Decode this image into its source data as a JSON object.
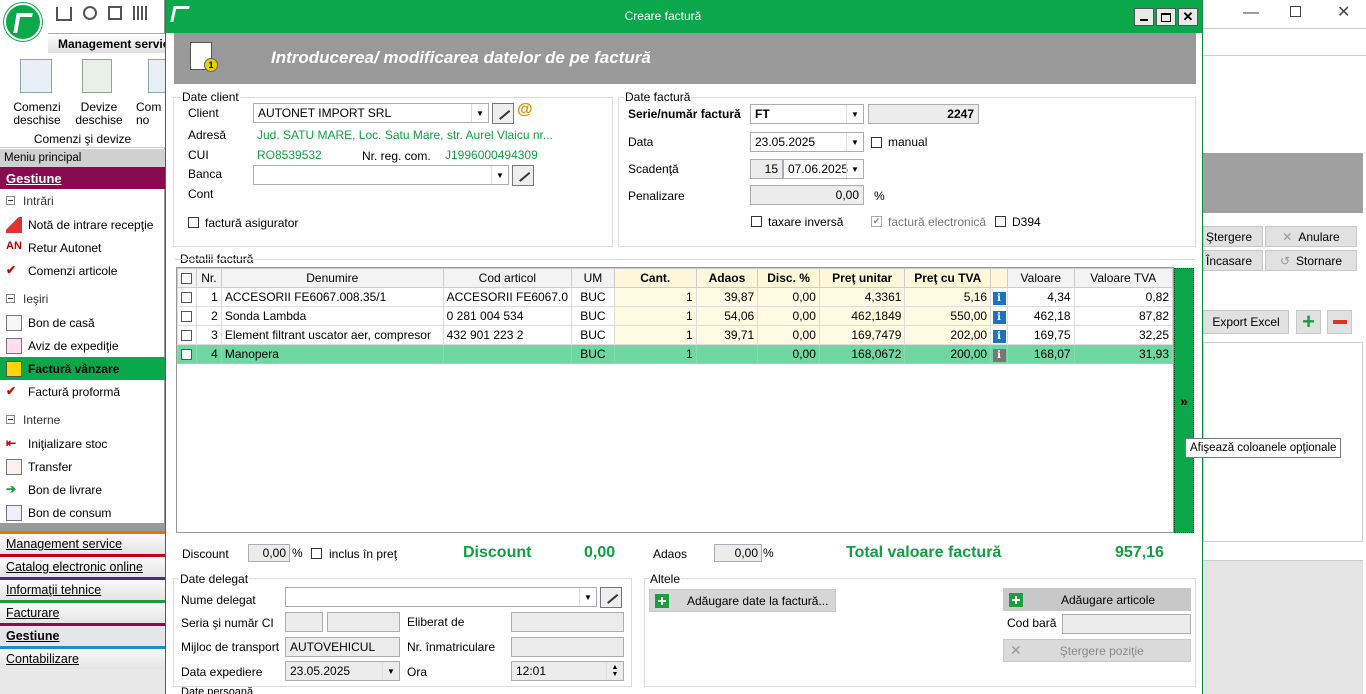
{
  "left_app": {
    "toolbar_title": "Management service",
    "ribbon_items": [
      {
        "label": "Comenzi\ndeschise"
      },
      {
        "label": "Devize\ndeschise"
      },
      {
        "label": "Com\nno"
      }
    ],
    "ribbon_group": "Comenzi şi devize",
    "menu_header": "Meniu principal",
    "section_title": "Gestiune",
    "groups": [
      {
        "label": "Intrări",
        "items": [
          "Notă de intrare recepţie",
          "Retur Autonet",
          "Comenzi articole"
        ]
      },
      {
        "label": "Ieşiri",
        "items": [
          "Bon de casă",
          "Aviz de expediţie",
          "Factură vânzare",
          "Factură proformă"
        ]
      },
      {
        "label": "Interne",
        "items": [
          "Iniţializare stoc",
          "Transfer",
          "Bon de livrare",
          "Bon de consum"
        ]
      }
    ],
    "active_item": "Factură vânzare",
    "modules": [
      "Management service",
      "Catalog electronic online",
      "Informaţii tehnice",
      "Facturare",
      "Gestiune",
      "Contabilizare"
    ],
    "module_colors": [
      "#e07b00",
      "#c00018",
      "#4b2b8a",
      "#1f9a40",
      "#8a0a50",
      "#1a8fc8"
    ]
  },
  "right_app": {
    "buttons": {
      "stergere": "Ştergere",
      "anulare": "Anulare",
      "incasare": "Încasare",
      "stornare": "Stornare",
      "export": "Export Excel"
    },
    "tooltip": "Afişează coloanele opţionale"
  },
  "dialog": {
    "title": "Creare factură",
    "banner": "Introducerea/ modificarea datelor de pe factură",
    "client_section": {
      "legend": "Date client",
      "client_label": "Client",
      "client_value": "AUTONET IMPORT SRL",
      "adresa_label": "Adresă",
      "adresa_value": "Jud. SATU MARE, Loc. Satu Mare, str. Aurel Vlaicu nr...",
      "cui_label": "CUI",
      "cui_value": "RO8539532",
      "nrreg_label": "Nr. reg. com.",
      "nrreg_value": "J1996000494309",
      "banca_label": "Banca",
      "cont_label": "Cont",
      "asigurator_label": "factură asigurator"
    },
    "invoice_section": {
      "legend": "Date factură",
      "serie_label": "Serie/număr factură",
      "serie_value": "FT",
      "numar_value": "2247",
      "data_label": "Data",
      "data_value": "23.05.2025",
      "manual_label": "manual",
      "scadenta_label": "Scadenţă",
      "scadenta_days": "15",
      "scadenta_date": "07.06.2025",
      "penalizare_label": "Penalizare",
      "penalizare_value": "0,00",
      "penalizare_unit": "%",
      "taxare_label": "taxare inversă",
      "efactura_label": "factură electronică",
      "d394_label": "D394"
    },
    "details": {
      "legend": "Detalii factură",
      "columns": [
        "Nr.",
        "Denumire",
        "Cod articol",
        "UM",
        "Cant.",
        "Adaos",
        "Disc. %",
        "Preţ unitar",
        "Preţ cu TVA",
        "",
        "Valoare",
        "Valoare TVA"
      ],
      "rows": [
        {
          "nr": "1",
          "denumire": "ACCESORII FE6067.008.35/1",
          "cod": "ACCESORII FE6067.0",
          "um": "BUC",
          "cant": "1",
          "adaos": "39,87",
          "disc": "0,00",
          "pret": "4,3361",
          "pret_tva": "5,16",
          "valoare": "4,34",
          "valoare_tva": "0,82"
        },
        {
          "nr": "2",
          "denumire": "Sonda Lambda",
          "cod": "0 281 004 534",
          "um": "BUC",
          "cant": "1",
          "adaos": "54,06",
          "disc": "0,00",
          "pret": "462,1849",
          "pret_tva": "550,00",
          "valoare": "462,18",
          "valoare_tva": "87,82"
        },
        {
          "nr": "3",
          "denumire": "Element filtrant uscator aer, compresor",
          "cod": "432 901 223 2",
          "um": "BUC",
          "cant": "1",
          "adaos": "39,71",
          "disc": "0,00",
          "pret": "169,7479",
          "pret_tva": "202,00",
          "valoare": "169,75",
          "valoare_tva": "32,25"
        },
        {
          "nr": "4",
          "denumire": "Manopera",
          "cod": "",
          "um": "BUC",
          "cant": "1",
          "adaos": "",
          "disc": "0,00",
          "pret": "168,0672",
          "pret_tva": "200,00",
          "valoare": "168,07",
          "valoare_tva": "31,93"
        }
      ],
      "selected_row": 3
    },
    "totals": {
      "discount_label": "Discount",
      "discount_value": "0,00",
      "pct": "%",
      "inclus_label": "inclus în preţ",
      "discount_big_label": "Discount",
      "discount_big_value": "0,00",
      "adaos_label": "Adaos",
      "adaos_value": "0,00",
      "total_label": "Total valoare factură",
      "total_value": "957,16"
    },
    "delegat": {
      "legend": "Date delegat",
      "nume_label": "Nume delegat",
      "serie_ci_label": "Seria şi număr CI",
      "eliberat_label": "Eliberat de",
      "transport_label": "Mijloc de transport",
      "transport_value": "AUTOVEHICUL",
      "inmatriculare_label": "Nr. înmatriculare",
      "expediere_label": "Data expediere",
      "expediere_value": "23.05.2025",
      "ora_label": "Ora",
      "ora_value": "12:01",
      "next_legend": "Date persoană"
    },
    "altele": {
      "legend": "Altele",
      "add_date_label": "Adăugare date la factură...",
      "add_articole_label": "Adăugare articole",
      "cod_bara_label": "Cod bară",
      "stergere_label": "Ştergere poziţie"
    }
  }
}
